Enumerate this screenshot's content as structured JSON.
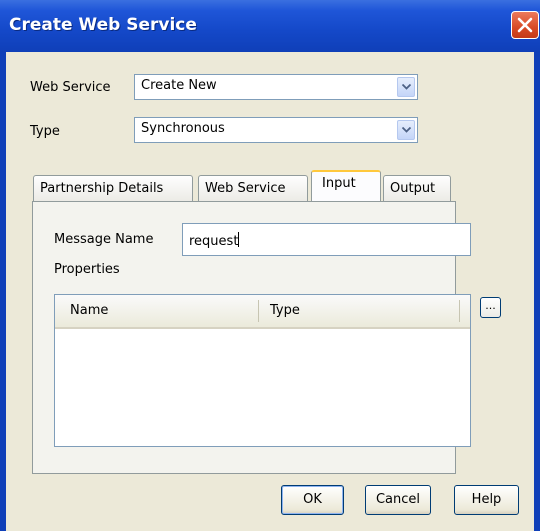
{
  "dialog": {
    "title": "Create Web Service",
    "close_icon": "close-icon"
  },
  "form": {
    "web_service_label": "Web Service",
    "web_service_value": "Create New",
    "type_label": "Type",
    "type_value": "Synchronous"
  },
  "tabs": [
    {
      "label": "Partnership Details",
      "selected": false
    },
    {
      "label": "Web Service",
      "selected": false
    },
    {
      "label": "Input",
      "selected": true
    },
    {
      "label": "Output",
      "selected": false
    }
  ],
  "input_tab": {
    "message_name_label": "Message Name",
    "message_name_value": "request",
    "properties_label": "Properties",
    "table_columns": [
      "Name",
      "Type"
    ],
    "browse_button": "..."
  },
  "buttons": {
    "ok": "OK",
    "cancel": "Cancel",
    "help": "Help"
  },
  "colors": {
    "titlebar": "#1448c8",
    "close_button": "#d84a26",
    "dialog_bg": "#ece9d8",
    "active_tab_highlight": "#ffc83c"
  }
}
